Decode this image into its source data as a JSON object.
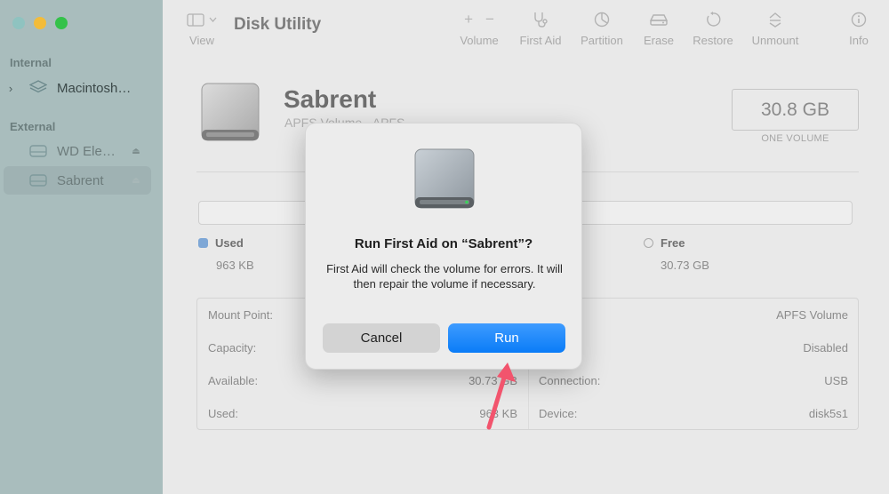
{
  "window": {
    "title": "Disk Utility"
  },
  "sidebar": {
    "sections": [
      {
        "label": "Internal",
        "items": [
          {
            "label": "Macintosh…",
            "expandable": true,
            "icon": "layers-icon"
          }
        ]
      },
      {
        "label": "External",
        "items": [
          {
            "label": "WD Ele…",
            "icon": "external-drive-icon",
            "eject": true
          },
          {
            "label": "Sabrent",
            "icon": "external-drive-icon",
            "eject": true,
            "selected": true
          }
        ]
      }
    ]
  },
  "toolbar": {
    "view_label": "View",
    "volume_label": "Volume",
    "first_aid_label": "First Aid",
    "partition_label": "Partition",
    "erase_label": "Erase",
    "restore_label": "Restore",
    "unmount_label": "Unmount",
    "info_label": "Info"
  },
  "volume": {
    "name": "Sabrent",
    "subtitle": "APFS Volume - APFS",
    "size": "30.8 GB",
    "size_caption": "ONE VOLUME",
    "used_label": "Used",
    "used_value": "963 KB",
    "free_label": "Free",
    "free_value": "30.73 GB",
    "used_color": "#7ea7d6"
  },
  "info": {
    "left": [
      {
        "key": "Mount Point:",
        "value": ""
      },
      {
        "key": "Capacity:",
        "value": ""
      },
      {
        "key": "Available:",
        "value": "30.73 GB"
      },
      {
        "key": "Used:",
        "value": "963 KB"
      }
    ],
    "right": [
      {
        "key": "",
        "value": "APFS Volume"
      },
      {
        "key": "",
        "value": "Disabled"
      },
      {
        "key": "Connection:",
        "value": "USB"
      },
      {
        "key": "Device:",
        "value": "disk5s1"
      }
    ]
  },
  "dialog": {
    "title": "Run First Aid on “Sabrent”?",
    "body": "First Aid will check the volume for errors. It will then repair the volume if necessary.",
    "cancel_label": "Cancel",
    "run_label": "Run",
    "accent": "#0a7cf7"
  }
}
